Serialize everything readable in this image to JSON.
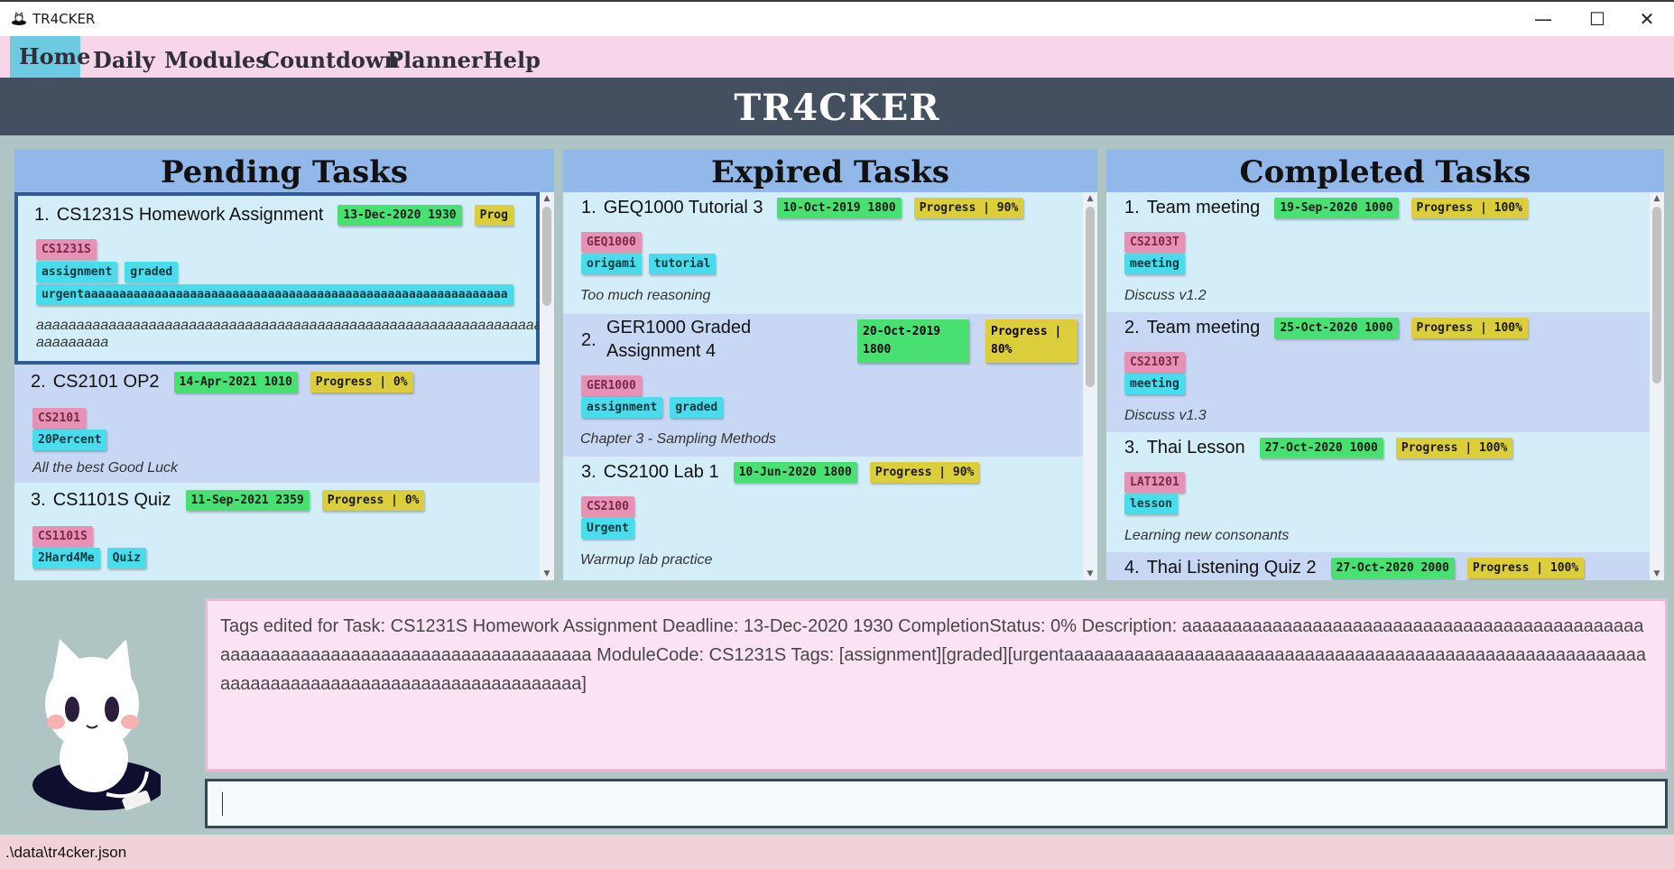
{
  "window": {
    "title": "TR4CKER",
    "minimize": "—",
    "maximize": "☐",
    "close": "✕"
  },
  "menu": {
    "items": [
      "Home",
      "Daily",
      "Modules",
      "Countdown",
      "Planner",
      "Help"
    ],
    "active": "Home"
  },
  "header": {
    "title": "TR4CKER"
  },
  "panels": {
    "pending": {
      "title": "Pending Tasks",
      "tasks": [
        {
          "index": "1.",
          "name": "CS1231S Homework Assignment",
          "deadline": "13-Dec-2020 1930",
          "progress": "Prog",
          "module": "CS1231S",
          "tags": [
            "assignment",
            "graded",
            "urgentaaaaaaaaaaaaaaaaaaaaaaaaaaaaaaaaaaaaaaaaaaaaaaaaaaaaaaaaaaaa"
          ],
          "description": "aaaaaaaaaaaaaaaaaaaaaaaaaaaaaaaaaaaaaaaaaaaaaaaaaaaaaaaaaaaaaaa",
          "description2": "aaaaaaaaa"
        },
        {
          "index": "2.",
          "name": "CS2101 OP2",
          "deadline": "14-Apr-2021 1010",
          "progress": "Progress | 0%",
          "module": "CS2101",
          "tags": [
            "20Percent"
          ],
          "description": "All the best Good Luck"
        },
        {
          "index": "3.",
          "name": "CS1101S Quiz",
          "deadline": "11-Sep-2021 2359",
          "progress": "Progress | 0%",
          "module": "CS1101S",
          "tags": [
            "2Hard4Me",
            "Quiz"
          ]
        }
      ]
    },
    "expired": {
      "title": "Expired Tasks",
      "tasks": [
        {
          "index": "1.",
          "name": "GEQ1000 Tutorial 3",
          "deadline": "10-Oct-2019 1800",
          "progress": "Progress | 90%",
          "module": "GEQ1000",
          "tags": [
            "origami",
            "tutorial"
          ],
          "description": "Too much reasoning"
        },
        {
          "index": "2.",
          "name": "GER1000 Graded",
          "name2": "Assignment 4",
          "deadline": "20-Oct-2019",
          "deadline2": "1800",
          "progress": "Progress |",
          "progress2": "80%",
          "module": "GER1000",
          "tags": [
            "assignment",
            "graded"
          ],
          "description": "Chapter 3 - Sampling Methods"
        },
        {
          "index": "3.",
          "name": "CS2100 Lab 1",
          "deadline": "10-Jun-2020 1800",
          "progress": "Progress | 90%",
          "module": "CS2100",
          "tags": [
            "Urgent"
          ],
          "description": "Warmup lab practice"
        }
      ]
    },
    "completed": {
      "title": "Completed Tasks",
      "tasks": [
        {
          "index": "1.",
          "name": "Team meeting",
          "deadline": "19-Sep-2020 1000",
          "progress": "Progress | 100%",
          "module": "CS2103T",
          "tags": [
            "meeting"
          ],
          "description": "Discuss v1.2"
        },
        {
          "index": "2.",
          "name": "Team meeting",
          "deadline": "25-Oct-2020 1000",
          "progress": "Progress | 100%",
          "module": "CS2103T",
          "tags": [
            "meeting"
          ],
          "description": "Discuss v1.3"
        },
        {
          "index": "3.",
          "name": "Thai Lesson",
          "deadline": "27-Oct-2020 1000",
          "progress": "Progress | 100%",
          "module": "LAT1201",
          "tags": [
            "lesson"
          ],
          "description": "Learning new consonants"
        },
        {
          "index": "4.",
          "name": "Thai Listening Quiz 2",
          "deadline": "27-Oct-2020 2000",
          "progress": "Progress | 100%"
        }
      ]
    }
  },
  "result": {
    "text": "Tags edited for Task: CS1231S Homework Assignment Deadline: 13-Dec-2020 1930 CompletionStatus: 0% Description: aaaaaaaaaaaaaaaaaaaaaaaaaaaaaaaaaaaaaaaaaaaaaaaaaaaaaaaaaaaaaaaaaaaaaaaaaaaaaaaaaaa ModuleCode: CS1231S Tags: [assignment][graded][urgentaaaaaaaaaaaaaaaaaaaaaaaaaaaaaaaaaaaaaaaaaaaaaaaaaaaaaaaaaaaaaaaaaaaaaaaaaaaaaaaaaaaaaaaaaaaaaa]"
  },
  "command": {
    "value": "",
    "placeholder": ""
  },
  "status": {
    "path": ".\\data\\tr4cker.json"
  },
  "colors": {
    "menu_bg": "#f7d6ea",
    "menu_active": "#6ccbe0",
    "header_bg": "#444f5f",
    "panel_head": "#92b8ea",
    "date_pill": "#48e070",
    "progress_pill": "#dccd3a",
    "module_pill": "#e791b5",
    "tag_pill": "#49dcec"
  },
  "icons": {
    "app": "cat-app-icon",
    "mascot": "cat-mascot-icon"
  }
}
